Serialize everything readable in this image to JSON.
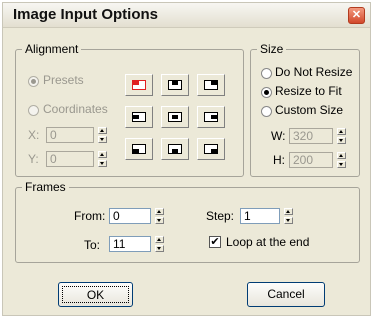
{
  "window": {
    "title": "Image Input Options",
    "close_label": "✕"
  },
  "alignment": {
    "legend": "Alignment",
    "presets_label": "Presets",
    "coordinates_label": "Coordinates",
    "x_label": "X:",
    "y_label": "Y:",
    "x_value": "0",
    "y_value": "0",
    "selected_position": "top-left"
  },
  "size": {
    "legend": "Size",
    "do_not_resize_label": "Do Not Resize",
    "resize_to_fit_label": "Resize to Fit",
    "custom_size_label": "Custom Size",
    "selected": "Resize to Fit",
    "w_label": "W:",
    "h_label": "H:",
    "w_value": "320",
    "h_value": "200"
  },
  "frames": {
    "legend": "Frames",
    "from_label": "From:",
    "from_value": "0",
    "to_label": "To:",
    "to_value": "11",
    "step_label": "Step:",
    "step_value": "1",
    "loop_label": "Loop at the end",
    "loop_checked": true
  },
  "buttons": {
    "ok_label": "OK",
    "cancel_label": "Cancel"
  },
  "icons": {
    "close": "close-icon",
    "spinner": "spinner-arrows-icon",
    "align": "alignment-position-icon",
    "checkmark": "checkmark-icon"
  },
  "colors": {
    "active_alignment": "#e02020",
    "dialog_bg": "#ece9d8"
  }
}
